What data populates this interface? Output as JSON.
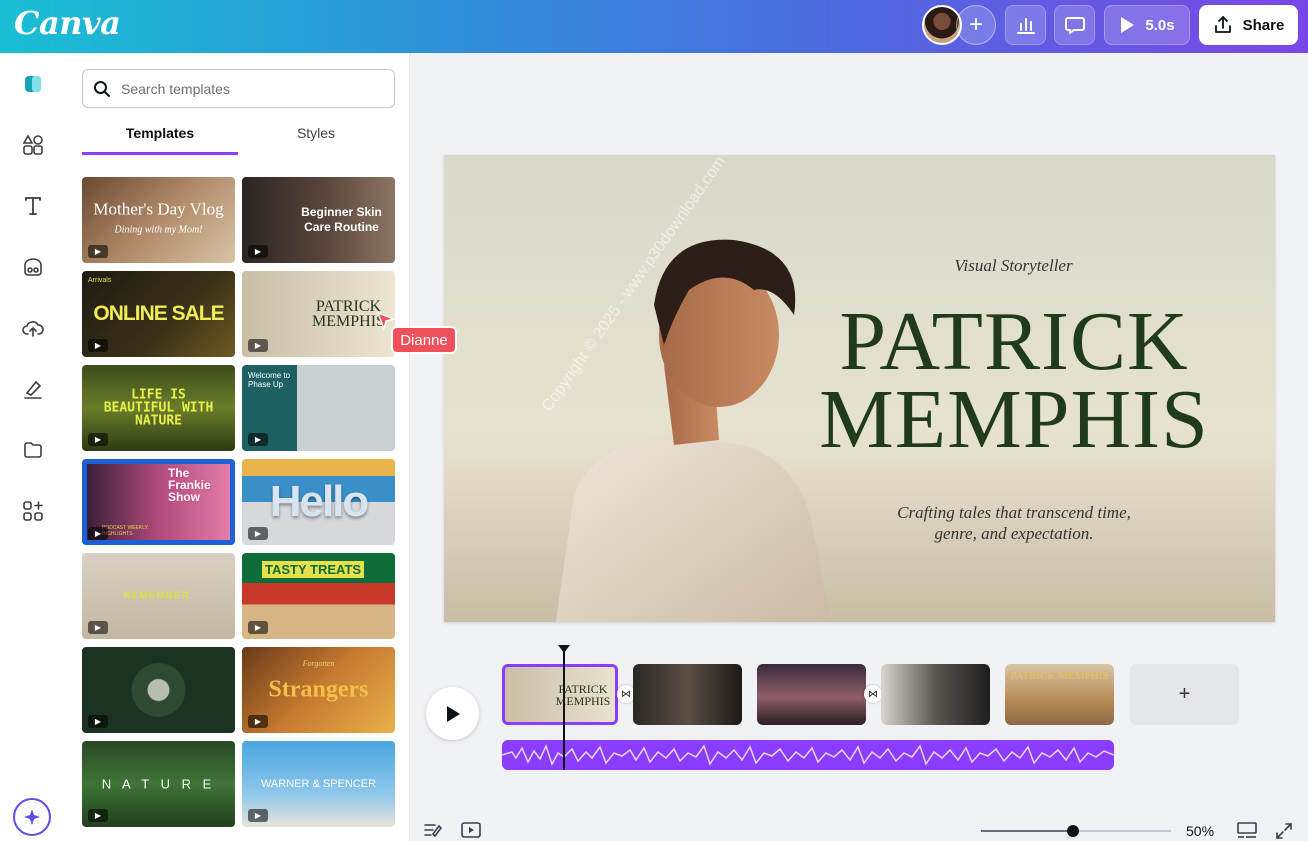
{
  "app": {
    "logo": "Canva"
  },
  "header": {
    "add_label": "+",
    "play_time": "5.0s",
    "share_label": "Share"
  },
  "rail": {
    "items": [
      "design-icon",
      "elements-icon",
      "text-icon",
      "brand-icon",
      "uploads-icon",
      "draw-icon",
      "projects-icon",
      "apps-icon"
    ],
    "magic": "sparkle-icon"
  },
  "search": {
    "placeholder": "Search templates"
  },
  "tabs": [
    {
      "label": "Templates",
      "active": true
    },
    {
      "label": "Styles",
      "active": false
    }
  ],
  "templates": [
    {
      "title": "Mother's Day Vlog",
      "subtitle": "Dining with my Mom!"
    },
    {
      "title": "Beginner Skin Care Routine"
    },
    {
      "title": "ONLINE SALE",
      "subtitle": "Arrivals"
    },
    {
      "title": "PATRICK MEMPHIS"
    },
    {
      "title": "LIFE IS BEAUTIFUL WITH NATURE"
    },
    {
      "title": "Welcome to Phase Up"
    },
    {
      "title": "The Frankie Show",
      "subtitle": "PODCAST WEEKLY HIGHLIGHTS"
    },
    {
      "title": "Hello"
    },
    {
      "title": "REMEMBER."
    },
    {
      "title": "TASTY TREATS"
    },
    {
      "title": ""
    },
    {
      "title": "Strangers",
      "subtitle": "Forgotten"
    },
    {
      "title": "N A T U R E"
    },
    {
      "title": "WARNER & SPENCER"
    }
  ],
  "slide": {
    "kicker": "Visual Storyteller",
    "name_line1": "PATRICK",
    "name_line2": "MEMPHIS",
    "tagline_line1": "Crafting tales that transcend time,",
    "tagline_line2": "genre, and expectation.",
    "watermark": "Copyright © 2025 - www.p30download.com"
  },
  "collaborator": {
    "name": "Dianne",
    "color": "#f0505a"
  },
  "timeline": {
    "clips": [
      "PATRICK MEMPHIS",
      "",
      "",
      "",
      "PATRICK MEMPHIS"
    ],
    "add_label": "+"
  },
  "bottom": {
    "zoom": "50%"
  },
  "colors": {
    "accent": "#8b3dff",
    "title_green": "#1f3b1c"
  }
}
